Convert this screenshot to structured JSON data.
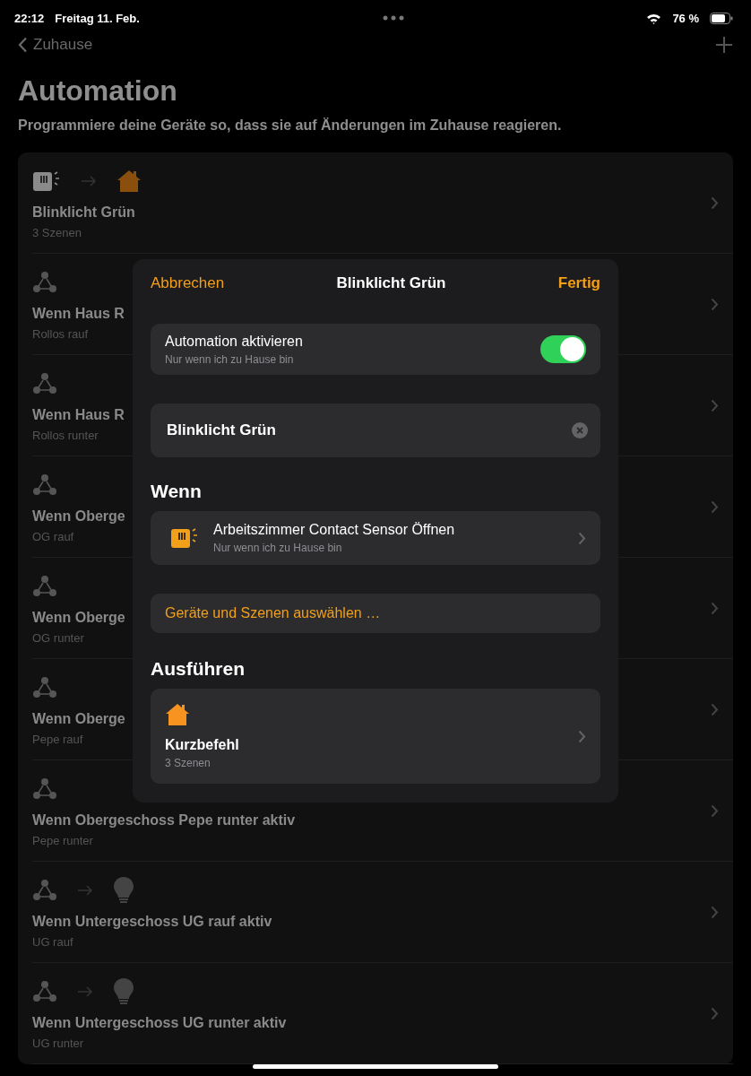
{
  "status_bar": {
    "time": "22:12",
    "date": "Freitag 11. Feb.",
    "battery": "76 %"
  },
  "nav": {
    "back": "Zuhause"
  },
  "title": "Automation",
  "subtitle": "Programmiere deine Geräte so, dass sie auf Änderungen im Zuhause reagieren.",
  "automations": [
    {
      "title": "Blinklicht Grün",
      "detail": "3 Szenen",
      "icons": [
        {
          "kind": "sensor"
        },
        {
          "kind": "home"
        }
      ]
    },
    {
      "title": "Wenn Haus R",
      "detail": "Rollos rauf",
      "icons": [
        {
          "kind": "nodes"
        }
      ]
    },
    {
      "title": "Wenn Haus R",
      "detail": "Rollos runter",
      "icons": [
        {
          "kind": "nodes"
        }
      ]
    },
    {
      "title": "Wenn Oberge",
      "detail": "OG rauf",
      "icons": [
        {
          "kind": "nodes"
        }
      ]
    },
    {
      "title": "Wenn Oberge",
      "detail": "OG runter",
      "icons": [
        {
          "kind": "nodes"
        }
      ]
    },
    {
      "title": "Wenn Oberge",
      "detail": "Pepe rauf",
      "icons": [
        {
          "kind": "nodes"
        }
      ]
    },
    {
      "title": "Wenn Obergeschoss Pepe runter aktiv",
      "detail": "Pepe runter",
      "icons": [
        {
          "kind": "nodes"
        }
      ]
    },
    {
      "title": "Wenn Untergeschoss UG rauf aktiv",
      "detail": "UG rauf",
      "icons": [
        {
          "kind": "nodes"
        },
        {
          "kind": "bulb"
        }
      ]
    },
    {
      "title": "Wenn Untergeschoss UG runter aktiv",
      "detail": "UG runter",
      "icons": [
        {
          "kind": "nodes"
        },
        {
          "kind": "bulb"
        }
      ]
    }
  ],
  "sheet": {
    "cancel": "Abbrechen",
    "title": "Blinklicht Grün",
    "done": "Fertig",
    "enable": {
      "label": "Automation aktivieren",
      "detail": "Nur wenn ich zu Hause bin",
      "on": true
    },
    "name_field": {
      "value": "Blinklicht Grün"
    },
    "when_heading": "Wenn",
    "trigger": {
      "label": "Arbeitszimmer Contact Sensor Öffnen",
      "detail": "Nur wenn ich zu Hause bin"
    },
    "select_link": "Geräte und Szenen auswählen …",
    "run_heading": "Ausführen",
    "action": {
      "label": "Kurzbefehl",
      "detail": "3 Szenen"
    }
  }
}
